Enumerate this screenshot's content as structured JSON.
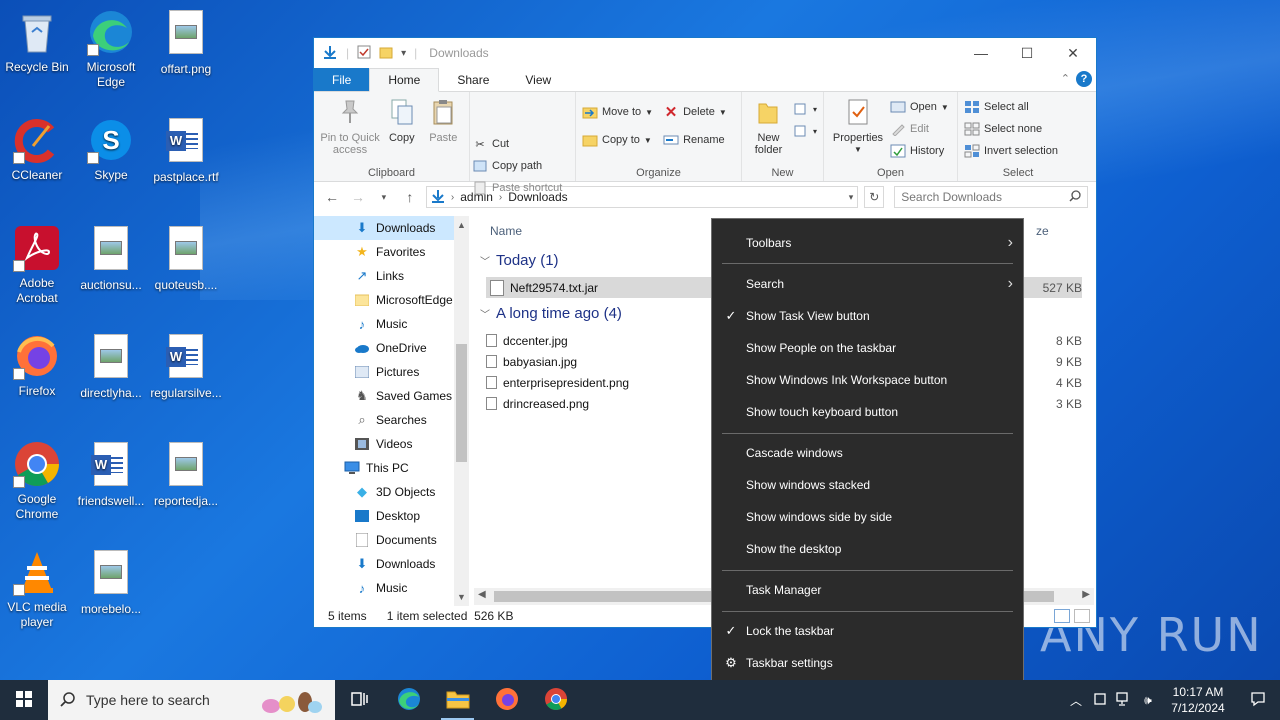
{
  "desktop": {
    "icons": [
      {
        "label": "Recycle Bin"
      },
      {
        "label": "Microsoft Edge"
      },
      {
        "label": "offart.png"
      },
      {
        "label": "CCleaner"
      },
      {
        "label": "Skype"
      },
      {
        "label": "pastplace.rtf"
      },
      {
        "label": "Adobe Acrobat"
      },
      {
        "label": "auctionsu..."
      },
      {
        "label": "quoteusb...."
      },
      {
        "label": "Firefox"
      },
      {
        "label": "directlyha..."
      },
      {
        "label": "regularsilve..."
      },
      {
        "label": "Google Chrome"
      },
      {
        "label": "friendswell..."
      },
      {
        "label": "reportedja..."
      },
      {
        "label": "VLC media player"
      },
      {
        "label": "morebelo..."
      }
    ]
  },
  "explorer": {
    "title": "Downloads",
    "tabs": {
      "file": "File",
      "home": "Home",
      "share": "Share",
      "view": "View"
    },
    "ribbon": {
      "pin": "Pin to Quick access",
      "copy": "Copy",
      "paste": "Paste",
      "cut": "Cut",
      "copy_path": "Copy path",
      "paste_shortcut": "Paste shortcut",
      "clipboard": "Clipboard",
      "move_to": "Move to",
      "copy_to": "Copy to",
      "delete": "Delete",
      "rename": "Rename",
      "organize": "Organize",
      "new_folder": "New folder",
      "new": "New",
      "properties": "Properties",
      "open": "Open",
      "edit": "Edit",
      "history": "History",
      "open_group": "Open",
      "select_all": "Select all",
      "select_none": "Select none",
      "invert_selection": "Invert selection",
      "select": "Select"
    },
    "address": {
      "part1": "admin",
      "part2": "Downloads",
      "search_placeholder": "Search Downloads"
    },
    "nav": [
      {
        "label": "Downloads"
      },
      {
        "label": "Favorites"
      },
      {
        "label": "Links"
      },
      {
        "label": "MicrosoftEdge"
      },
      {
        "label": "Music"
      },
      {
        "label": "OneDrive"
      },
      {
        "label": "Pictures"
      },
      {
        "label": "Saved Games"
      },
      {
        "label": "Searches"
      },
      {
        "label": "Videos"
      },
      {
        "label": "This PC"
      },
      {
        "label": "3D Objects"
      },
      {
        "label": "Desktop"
      },
      {
        "label": "Documents"
      },
      {
        "label": "Downloads"
      },
      {
        "label": "Music"
      }
    ],
    "files": {
      "col_name": "Name",
      "col_size": "ze",
      "group_today": "Today (1)",
      "group_old": "A long time ago (4)",
      "rows": [
        {
          "name": "Neft29574.txt.jar",
          "size": "527 KB"
        },
        {
          "name": "dccenter.jpg",
          "size": "8 KB"
        },
        {
          "name": "babyasian.jpg",
          "size": "9 KB"
        },
        {
          "name": "enterprisepresident.png",
          "size": "4 KB"
        },
        {
          "name": "drincreased.png",
          "size": "3 KB"
        }
      ]
    },
    "status": {
      "items": "5 items",
      "selected": "1 item selected",
      "size": "526 KB"
    }
  },
  "context_menu": {
    "items": [
      {
        "label": "Toolbars"
      },
      {
        "label": "Search"
      },
      {
        "label": "Show Task View button"
      },
      {
        "label": "Show People on the taskbar"
      },
      {
        "label": "Show Windows Ink Workspace button"
      },
      {
        "label": "Show touch keyboard button"
      },
      {
        "label": "Cascade windows"
      },
      {
        "label": "Show windows stacked"
      },
      {
        "label": "Show windows side by side"
      },
      {
        "label": "Show the desktop"
      },
      {
        "label": "Task Manager"
      },
      {
        "label": "Lock the taskbar"
      },
      {
        "label": "Taskbar settings"
      }
    ]
  },
  "watermark": "ANY RUN",
  "taskbar": {
    "search_placeholder": "Type here to search",
    "time": "10:17 AM",
    "date": "7/12/2024"
  },
  "colors": {
    "accent": "#1979ca",
    "menu_bg": "#2b2b2b",
    "taskbar_bg": "#1f2d3d"
  }
}
